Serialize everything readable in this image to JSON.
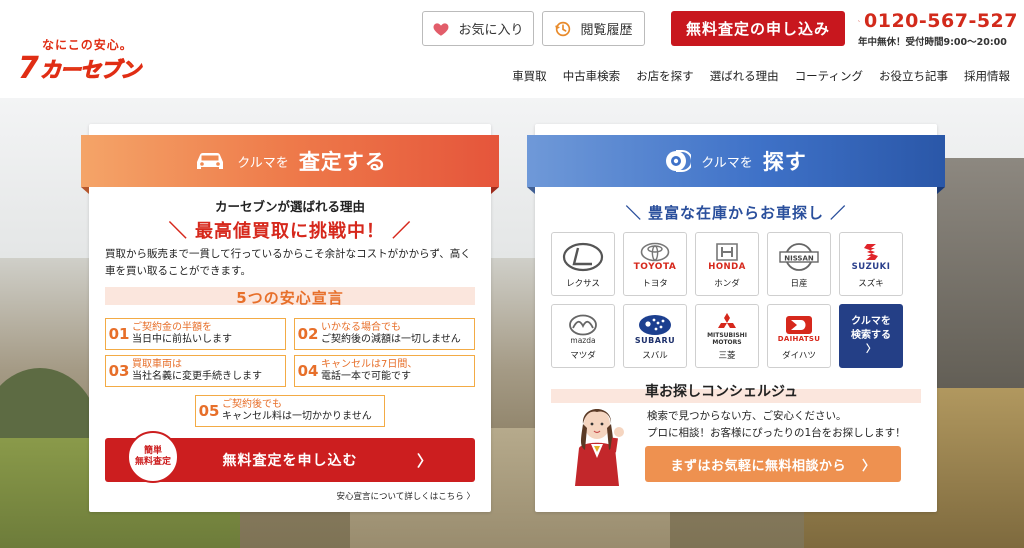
{
  "brand": {
    "tagline": "なにこの安心。",
    "logo_seven": "7",
    "logo_name": "カーセブン"
  },
  "header": {
    "favorites": "お気に入り",
    "history": "閲覧履歴",
    "assess_button": "無料査定の申し込み",
    "phone_number": "0120-567-527",
    "phone_hours": "年中無休！受付時間9:00～20:00"
  },
  "nav": [
    "車買取",
    "中古車検索",
    "お店を探す",
    "選ばれる理由",
    "コーティング",
    "お役立ち記事",
    "採用情報"
  ],
  "sell": {
    "ribbon_small": "クルマを",
    "ribbon_big": "査定する",
    "reason_sub": "カーセブンが選ばれる理由",
    "reason_main": "＼ 最高値買取に挑戦中！ ／",
    "reason_desc": "買取から販売まで一貫して行っているからこそ余計なコストがかからず、高く車を買い取ることができます。",
    "declaration_title": "5つの安心宣言",
    "declarations": [
      {
        "num": "01",
        "l1": "ご契約金の半額を",
        "l2": "当日中に前払いします"
      },
      {
        "num": "02",
        "l1": "いかなる場合でも",
        "l2": "ご契約後の減額は一切しません"
      },
      {
        "num": "03",
        "l1": "買取車両は",
        "l2": "当社名義に変更手続きします"
      },
      {
        "num": "04",
        "l1": "キャンセルは7日間、",
        "l2": "電話一本で可能です"
      },
      {
        "num": "05",
        "l1": "ご契約後でも",
        "l2": "キャンセル料は一切かかりません"
      }
    ],
    "cta_badge_l1": "簡単",
    "cta_badge_l2": "無料査定",
    "cta_label": "無料査定を申し込む",
    "cta_arrow": "〉",
    "declaration_link": "安心宣言について詳しくはこちら 〉"
  },
  "find": {
    "ribbon_small": "クルマを",
    "ribbon_big": "探す",
    "stock_title": "＼ 豊富な在庫からお車探し ／",
    "brands": [
      {
        "name": "レクサス",
        "logo": "lexus"
      },
      {
        "name": "トヨタ",
        "logo": "TOYOTA"
      },
      {
        "name": "ホンダ",
        "logo": "HONDA"
      },
      {
        "name": "日産",
        "logo": "NISSAN"
      },
      {
        "name": "スズキ",
        "logo": "SUZUKI"
      },
      {
        "name": "マツダ",
        "logo": "mazda"
      },
      {
        "name": "スバル",
        "logo": "SUBARU"
      },
      {
        "name": "三菱",
        "logo_l1": "MITSUBISHI",
        "logo_l2": "MOTORS"
      },
      {
        "name": "ダイハツ",
        "logo": "DAIHATSU"
      }
    ],
    "search_tile_l1": "クルマを",
    "search_tile_l2": "検索する",
    "search_tile_arrow": "〉",
    "concierge_title": "車お探しコンシェルジュ",
    "concierge_desc_l1": "検索で見つからない方、ご安心ください。",
    "concierge_desc_l2": "プロに相談！お客様にぴったりの1台をお探しします！",
    "concierge_button": "まずはお気軽に無料相談から",
    "concierge_arrow": "〉"
  },
  "colors": {
    "brand_red": "#c8171e",
    "sell_orange": "#e76f2a",
    "find_blue": "#2a4f9c"
  }
}
